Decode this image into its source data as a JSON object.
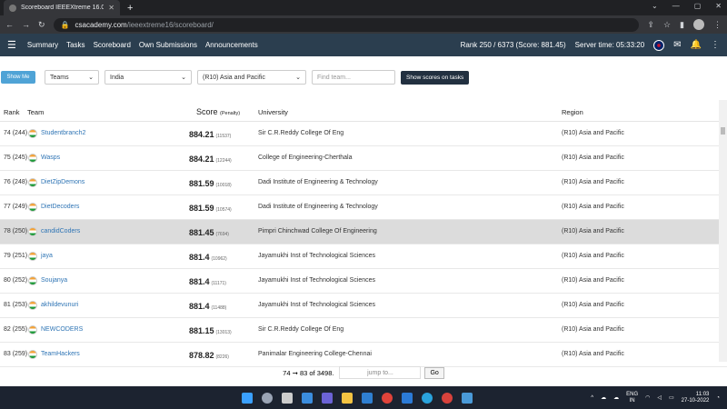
{
  "browser": {
    "tab_title": "Scoreboard IEEEXtreme 16.0",
    "url_host": "csacademy.com",
    "url_path": "/ieeextreme16/scoreboard/"
  },
  "nav": {
    "items": [
      "Summary",
      "Tasks",
      "Scoreboard",
      "Own Submissions",
      "Announcements"
    ],
    "rank_text": "Rank 250 / 6373 (Score: 881.45)",
    "server_time": "Server time: 05:33:20"
  },
  "filters": {
    "show_me": "Show Me",
    "type_select": "Teams",
    "country_select": "India",
    "region_select": "(R10) Asia and Pacific",
    "search_placeholder": "Find team...",
    "show_scores": "Show scores on tasks"
  },
  "table": {
    "headers": {
      "rank": "Rank",
      "team": "Team",
      "score": "Score",
      "penalty": "(Penalty)",
      "university": "University",
      "region": "Region"
    },
    "rows": [
      {
        "rank": "74 (244)",
        "team": "Studentbranch2",
        "score": "884.21",
        "penalty": "(11537)",
        "university": "Sir C.R.Reddy College Of Eng",
        "region": "(R10) Asia and Pacific"
      },
      {
        "rank": "75 (245)",
        "team": "Wasps",
        "score": "884.21",
        "penalty": "(12244)",
        "university": "College of Engineering-Cherthala",
        "region": "(R10) Asia and Pacific"
      },
      {
        "rank": "76 (248)",
        "team": "DietZipDemons",
        "score": "881.59",
        "penalty": "(10018)",
        "university": "Dadi Institute of Engineering & Technology",
        "region": "(R10) Asia and Pacific"
      },
      {
        "rank": "77 (249)",
        "team": "DietDecoders",
        "score": "881.59",
        "penalty": "(10574)",
        "university": "Dadi Institute of Engineering & Technology",
        "region": "(R10) Asia and Pacific"
      },
      {
        "rank": "78 (250)",
        "team": "candidCoders",
        "score": "881.45",
        "penalty": "(7694)",
        "university": "Pimpri Chinchwad College Of Engineering",
        "region": "(R10) Asia and Pacific"
      },
      {
        "rank": "79 (251)",
        "team": "jaya",
        "score": "881.4",
        "penalty": "(10962)",
        "university": "Jayamukhi Inst of Technological Sciences",
        "region": "(R10) Asia and Pacific"
      },
      {
        "rank": "80 (252)",
        "team": "Soujanya",
        "score": "881.4",
        "penalty": "(11171)",
        "university": "Jayamukhi Inst of Technological Sciences",
        "region": "(R10) Asia and Pacific"
      },
      {
        "rank": "81 (253)",
        "team": "akhildevunuri",
        "score": "881.4",
        "penalty": "(11488)",
        "university": "Jayamukhi Inst of Technological Sciences",
        "region": "(R10) Asia and Pacific"
      },
      {
        "rank": "82 (255)",
        "team": "NEWCODERS",
        "score": "881.15",
        "penalty": "(13013)",
        "university": "Sir C.R.Reddy College Of Eng",
        "region": "(R10) Asia and Pacific"
      },
      {
        "rank": "83 (259)",
        "team": "TeamHackers",
        "score": "878.82",
        "penalty": "(8226)",
        "university": "Panimalar Engineering College-Chennai",
        "region": "(R10) Asia and Pacific"
      }
    ],
    "highlighted_row_index": 4
  },
  "pager": {
    "range_text": "74 ➞ 83 of 3498.",
    "jump_placeholder": "jump to...",
    "go_label": "Go"
  },
  "taskbar": {
    "lang_line1": "ENG",
    "lang_line2": "IN",
    "time": "11:03",
    "date": "27-10-2022"
  },
  "colors": {
    "nav_bg": "#2b3e4f",
    "link": "#2f75b5",
    "highlight_row": "#dcdcdc",
    "show_me_btn": "#4fa3d6"
  }
}
